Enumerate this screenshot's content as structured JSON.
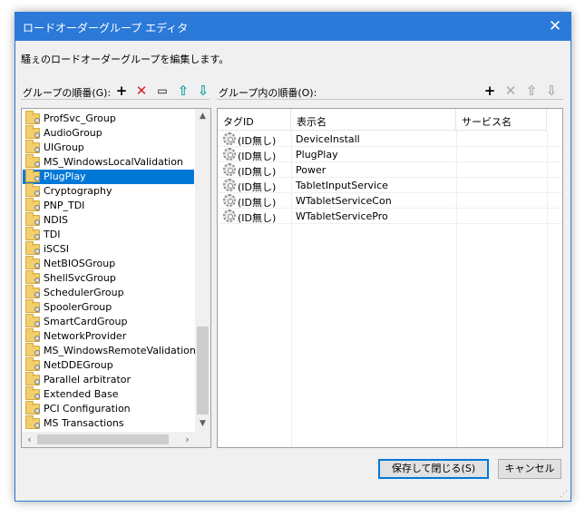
{
  "window": {
    "title": "ロードオーダーグループ エディタ",
    "close_glyph": "✕",
    "description": "騒ぇのロードオーダーグループを編集します。"
  },
  "left_panel": {
    "label": "グループの順番(G):",
    "items": [
      "ProfSvc_Group",
      "AudioGroup",
      "UIGroup",
      "MS_WindowsLocalValidation",
      "PlugPlay",
      "Cryptography",
      "PNP_TDI",
      "NDIS",
      "TDI",
      "iSCSI",
      "NetBIOSGroup",
      "ShellSvcGroup",
      "SchedulerGroup",
      "SpoolerGroup",
      "SmartCardGroup",
      "NetworkProvider",
      "MS_WindowsRemoteValidation",
      "NetDDEGroup",
      "Parallel arbitrator",
      "Extended Base",
      "PCI Configuration",
      "MS Transactions"
    ],
    "selected_index": 4
  },
  "right_panel": {
    "label": "グループ内の順番(O):",
    "columns": [
      "タグID",
      "表示名",
      "サービス名"
    ],
    "rows": [
      {
        "tag": "(ID無し)",
        "display": "DeviceInstall",
        "service": ""
      },
      {
        "tag": "(ID無し)",
        "display": "PlugPlay",
        "service": ""
      },
      {
        "tag": "(ID無し)",
        "display": "Power",
        "service": ""
      },
      {
        "tag": "(ID無し)",
        "display": "TabletInputService",
        "service": ""
      },
      {
        "tag": "(ID無し)",
        "display": "WTabletServiceCon",
        "service": ""
      },
      {
        "tag": "(ID無し)",
        "display": "WTabletServicePro",
        "service": ""
      }
    ]
  },
  "toolbar_glyphs": {
    "add": "+",
    "delete": "✕",
    "rename": "▭",
    "up": "⇧",
    "down": "⇩",
    "add_r": "+",
    "delete_r": "✕",
    "up_r": "⇧",
    "down_r": "⇩",
    "scroll_up": "▲",
    "scroll_down": "▼",
    "scroll_left": "‹",
    "scroll_right": "›",
    "grip": "⋰"
  },
  "colors": {
    "accent": "#2b79d8",
    "selection": "#0078d7",
    "delete_red": "#d32020",
    "arrow_teal": "#1aa3a3",
    "disabled": "#a8a8a8"
  },
  "buttons": {
    "save_close": "保存して閉じる(S)",
    "cancel": "キャンセル"
  }
}
